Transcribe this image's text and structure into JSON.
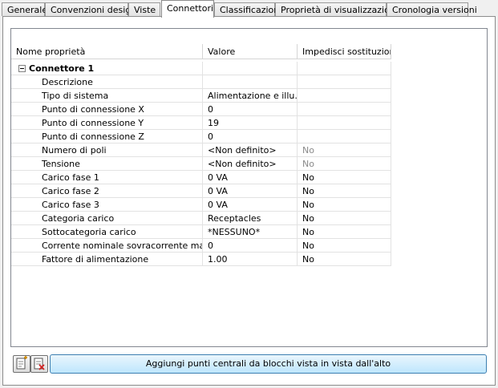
{
  "tabs": [
    {
      "label": "Generale"
    },
    {
      "label": "Convenzioni design"
    },
    {
      "label": "Viste"
    },
    {
      "label": "Connettori",
      "active": true
    },
    {
      "label": "Classificazioni"
    },
    {
      "label": "Proprietà di visualizzazione"
    },
    {
      "label": "Cronologia versioni"
    }
  ],
  "grid": {
    "headers": {
      "name": "Nome proprietà",
      "value": "Valore",
      "override": "Impedisci sostituzione"
    },
    "group": {
      "label": "Connettore 1",
      "expanded": true
    },
    "rows": [
      {
        "name": "Descrizione",
        "value": "",
        "override": ""
      },
      {
        "name": "Tipo di sistema",
        "value": "Alimentazione e illu...",
        "override": ""
      },
      {
        "name": "Punto di connessione X",
        "value": "0",
        "override": ""
      },
      {
        "name": "Punto di connessione Y",
        "value": "19",
        "override": ""
      },
      {
        "name": "Punto di connessione Z",
        "value": "0",
        "override": ""
      },
      {
        "name": "Numero di poli",
        "value": "<Non definito>",
        "override": "No",
        "disabled": true
      },
      {
        "name": "Tensione",
        "value": "<Non definito>",
        "override": "No",
        "disabled": true
      },
      {
        "name": "Carico fase 1",
        "value": "0 VA",
        "override": "No"
      },
      {
        "name": "Carico fase 2",
        "value": "0 VA",
        "override": "No"
      },
      {
        "name": "Carico fase 3",
        "value": "0 VA",
        "override": "No"
      },
      {
        "name": "Categoria carico",
        "value": "Receptacles",
        "override": "No"
      },
      {
        "name": "Sottocategoria carico",
        "value": "*NESSUNO*",
        "override": "No"
      },
      {
        "name": "Corrente nominale sovracorrente mas...",
        "value": "0",
        "override": "No"
      },
      {
        "name": "Fattore di alimentazione",
        "value": "1.00",
        "override": "No"
      }
    ]
  },
  "footer": {
    "add_button_icon": "add-connector-icon",
    "delete_button_icon": "delete-connector-icon",
    "main_button_label": "Aggiungi punti centrali da blocchi vista in vista dall'alto"
  },
  "colors": {
    "button_border": "#3c7fb1",
    "button_fill": "#bee6fd"
  }
}
